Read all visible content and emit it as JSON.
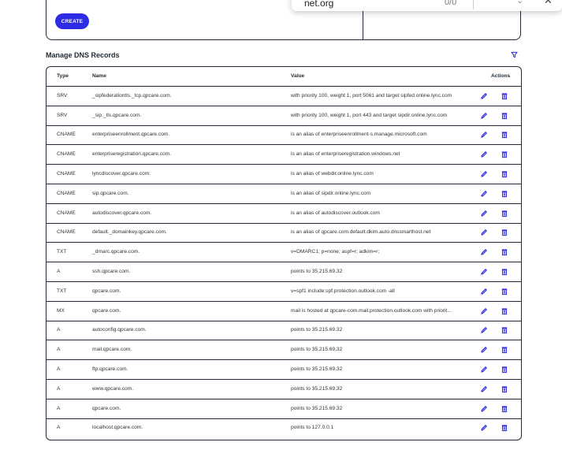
{
  "find_bar": {
    "query": "net.org",
    "count": "0/0",
    "prev_icon": "chevron-up-icon",
    "next_icon": "chevron-down-icon",
    "close_icon": "close-icon"
  },
  "top_card": {
    "create_label": "CREATE"
  },
  "dns": {
    "title": "Manage DNS Records",
    "filter_icon": "filter-icon",
    "accent": "#2d2be6",
    "headers": {
      "type": "Type",
      "name": "Name",
      "value": "Value",
      "actions": "Actions"
    },
    "records": [
      {
        "type": "SRV",
        "name": "_sipfederationtls._tcp.qpcare.com.",
        "value": "with priority 100, weight 1, port 5061 and target sipfed.online.lync.com"
      },
      {
        "type": "SRV",
        "name": "_sip._tls.qpcare.com.",
        "value": "with priority 100, weight 1, port 443 and target sipdir.online.lync.com"
      },
      {
        "type": "CNAME",
        "name": "enterpriseenrollment.qpcare.com.",
        "value": "is an alias of enterpriseenrollment-s.manage.microsoft.com"
      },
      {
        "type": "CNAME",
        "name": "enterpriseregistration.qpcare.com.",
        "value": "is an alias of enterpriseregistration.windows.net"
      },
      {
        "type": "CNAME",
        "name": "lyncdiscover.qpcare.com.",
        "value": "is an alias of webdir.online.lync.com"
      },
      {
        "type": "CNAME",
        "name": "sip.qpcare.com.",
        "value": "is an alias of sipdir.online.lync.com"
      },
      {
        "type": "CNAME",
        "name": "autodiscover.qpcare.com.",
        "value": "is an alias of autodiscover.outlook.com"
      },
      {
        "type": "CNAME",
        "name": "default._domainkey.qpcare.com.",
        "value": "is an alias of qpcare.com.default.dkim.auto.dnssmarthost.net"
      },
      {
        "type": "TXT",
        "name": "_dmarc.qpcare.com.",
        "value": "v=DMARC1; p=none; aspf=r; adkim=r;"
      },
      {
        "type": "A",
        "name": "ssh.qpcare.com.",
        "value": "points to 35.215.69.32"
      },
      {
        "type": "TXT",
        "name": "qpcare.com.",
        "value": "v=spf1 include:spf.protection.outlook.com -all"
      },
      {
        "type": "MX",
        "name": "qpcare.com.",
        "value": "mail is hosted at qpcare-com.mail.protection.outlook.com with priorit..."
      },
      {
        "type": "A",
        "name": "autoconfig.qpcare.com.",
        "value": "points to 35.215.69.32"
      },
      {
        "type": "A",
        "name": "mail.qpcare.com.",
        "value": "points to 35.215.69.32"
      },
      {
        "type": "A",
        "name": "ftp.qpcare.com.",
        "value": "points to 35.215.69.32"
      },
      {
        "type": "A",
        "name": "www.qpcare.com.",
        "value": "points to 35.215.69.32"
      },
      {
        "type": "A",
        "name": "qpcare.com.",
        "value": "points to 35.215.69.32"
      },
      {
        "type": "A",
        "name": "localhost.qpcare.com.",
        "value": "points to 127.0.0.1"
      }
    ]
  }
}
